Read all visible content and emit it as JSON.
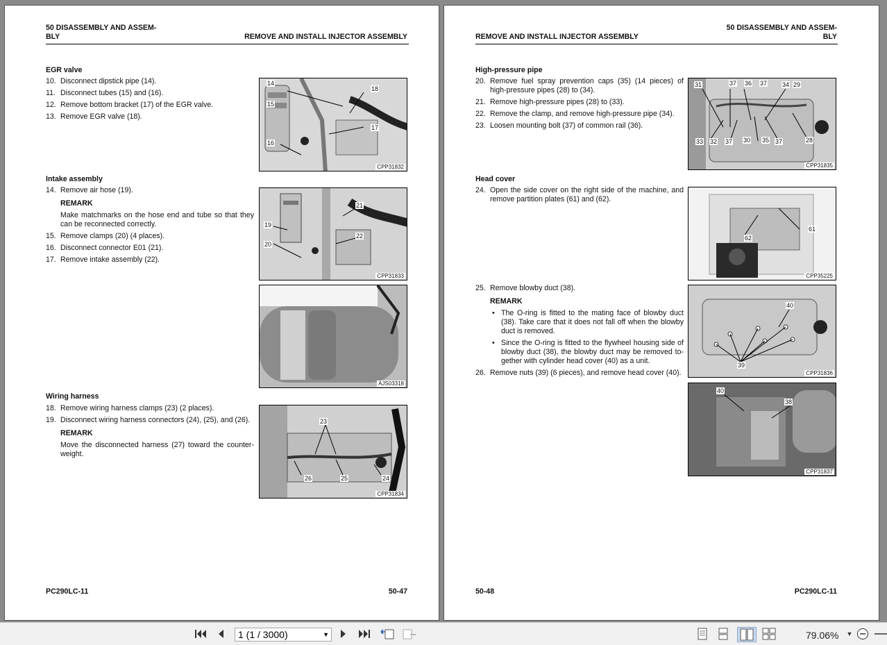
{
  "left_page": {
    "header_left": "50 DISASSEMBLY AND ASSEM-\nBLY",
    "header_right": "REMOVE AND INSTALL INJECTOR ASSEMBLY",
    "sections": {
      "egr": {
        "title": "EGR valve",
        "steps": [
          {
            "n": "10.",
            "t": "Disconnect dipstick pipe (14)."
          },
          {
            "n": "11.",
            "t": "Disconnect tubes (15) and (16)."
          },
          {
            "n": "12.",
            "t": "Remove bottom bracket (17) of the EGR valve."
          },
          {
            "n": "13.",
            "t": "Remove EGR valve (18)."
          }
        ]
      },
      "intake": {
        "title": "Intake assembly",
        "step14": {
          "n": "14.",
          "t": "Remove air hose (19)."
        },
        "remark_label": "REMARK",
        "remark_text": "Make matchmarks on the hose end and tube so that they can be reconnected correctly.",
        "steps": [
          {
            "n": "15.",
            "t": "Remove clamps (20) (4 places)."
          },
          {
            "n": "16.",
            "t": "Disconnect connector E01 (21)."
          },
          {
            "n": "17.",
            "t": "Remove intake assembly (22)."
          }
        ]
      },
      "wiring": {
        "title": "Wiring harness",
        "steps": [
          {
            "n": "18.",
            "t": "Remove wiring harness clamps (23) (2 places)."
          },
          {
            "n": "19.",
            "t": "Disconnect wiring harness connectors (24), (25), and (26)."
          }
        ],
        "remark_label": "REMARK",
        "remark_text": "Move the disconnected harness (27) toward the counter-weight."
      }
    },
    "figures": {
      "f1": {
        "code": "CPP31832",
        "callouts": [
          "14",
          "18",
          "15",
          "17",
          "16"
        ]
      },
      "f2": {
        "code": "CPP31833",
        "callouts": [
          "21",
          "19",
          "22",
          "20"
        ]
      },
      "f3": {
        "code": "AJS03318"
      },
      "f4": {
        "code": "CPP31834",
        "callouts": [
          "23",
          "26",
          "25",
          "24"
        ]
      }
    },
    "footer_left": "PC290LC-11",
    "footer_right": "50-47"
  },
  "right_page": {
    "header_left": "REMOVE AND INSTALL INJECTOR ASSEMBLY",
    "header_right": "50 DISASSEMBLY AND ASSEM-\nBLY",
    "sections": {
      "hp": {
        "title": "High-pressure pipe",
        "steps": [
          {
            "n": "20.",
            "t": "Remove fuel spray prevention caps (35) (14 pieces) of high-pressure pipes (28) to (34)."
          },
          {
            "n": "21.",
            "t": "Remove high-pressure pipes (28) to (33)."
          },
          {
            "n": "22.",
            "t": "Remove the clamp, and remove high-pressure pipe (34)."
          },
          {
            "n": "23.",
            "t": "Loosen mounting bolt (37) of common rail (36)."
          }
        ]
      },
      "head": {
        "title": "Head cover",
        "step24": {
          "n": "24.",
          "t": "Open the side cover on the right side of the machine, and remove partition plates (61) and (62)."
        },
        "step25": {
          "n": "25.",
          "t": "Remove blowby duct (38)."
        },
        "remark_label": "REMARK",
        "bullets": [
          "The O-ring is fitted to the mating face of blowby duct (38). Take care that it does not fall off when the blowby duct is removed.",
          "Since the O-ring is fitted to the flywheel housing side of blowby duct (38), the blowby duct may be removed to-gether with cylinder head cover (40) as a unit."
        ],
        "step26": {
          "n": "26.",
          "t": "Remove nuts (39) (6 pieces), and remove head cover (40)."
        }
      }
    },
    "figures": {
      "f5": {
        "code": "CPP31835",
        "callouts": [
          "31",
          "37",
          "36",
          "37",
          "34",
          "29",
          "33",
          "32",
          "37",
          "30",
          "35",
          "37",
          "28"
        ]
      },
      "f6": {
        "code": "CPP35225",
        "callouts": [
          "61",
          "62"
        ]
      },
      "f7": {
        "code": "CPP31836",
        "callouts": [
          "40",
          "39"
        ]
      },
      "f8": {
        "code": "CPP31837",
        "callouts": [
          "40",
          "38"
        ]
      }
    },
    "footer_left": "50-48",
    "footer_right": "PC290LC-11"
  },
  "toolbar": {
    "page_value": "1 (1 / 3000)",
    "zoom": "79.06%",
    "icons": [
      "first-page-icon",
      "prev-page-icon",
      "next-page-icon",
      "last-page-icon",
      "prev-view-icon",
      "next-view-icon",
      "single-page-icon",
      "continuous-icon",
      "facing-icon",
      "continuous-facing-icon",
      "zoom-dropdown-icon",
      "zoom-out-icon",
      "zoom-in-icon"
    ]
  }
}
